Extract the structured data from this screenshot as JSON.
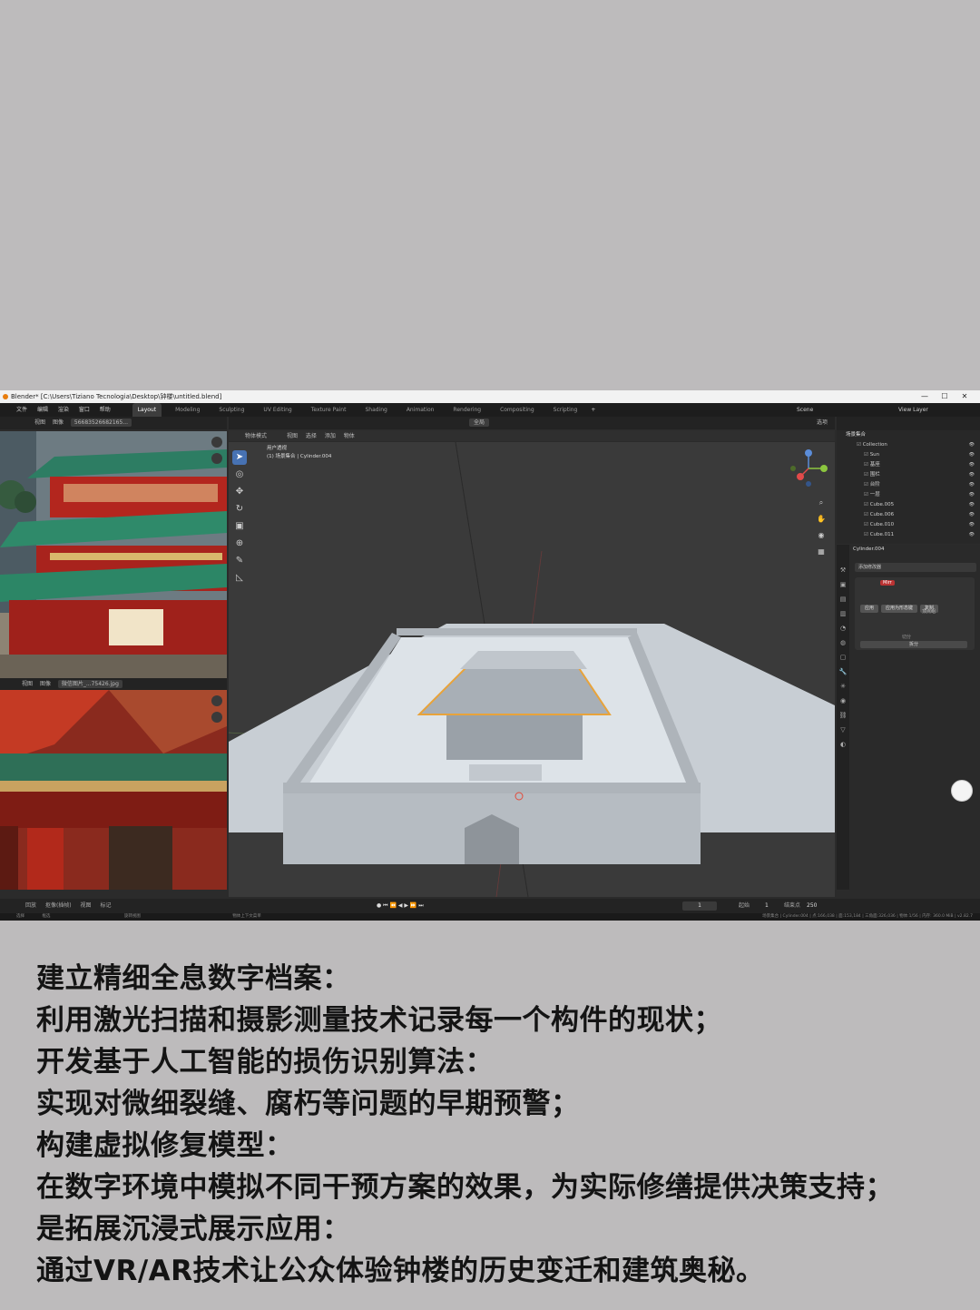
{
  "window": {
    "title": "Blender* [C:\\Users\\Tiziano Tecnologia\\Desktop\\钟楼\\untitled.blend]",
    "controls": [
      "—",
      "☐",
      "✕"
    ]
  },
  "menu": {
    "items": [
      "文件",
      "编辑",
      "渲染",
      "窗口",
      "帮助"
    ],
    "workspaces": [
      "Layout",
      "Modeling",
      "Sculpting",
      "UV Editing",
      "Texture Paint",
      "Shading",
      "Animation",
      "Rendering",
      "Compositing",
      "Scripting"
    ],
    "active_workspace": "Layout",
    "scene": "Scene",
    "view_layer": "View Layer"
  },
  "image_editor_top": {
    "menu": [
      "视图",
      "图像"
    ],
    "image_name": "566835266821​65..."
  },
  "image_editor_bottom": {
    "menu": [
      "视图",
      "图像"
    ],
    "image_name": "微信图片_...75426.jpg"
  },
  "viewport": {
    "mode": "物体模式",
    "menu": [
      "视图",
      "选择",
      "添加",
      "物体"
    ],
    "transform": "全局",
    "view_name": "用户透视",
    "object_label": "(1) 场景集合 | Cylinder.004",
    "options_label": "选项"
  },
  "outliner": {
    "header": "场景集合",
    "rows": [
      {
        "name": "Collection"
      },
      {
        "name": "Sun"
      },
      {
        "name": "基座"
      },
      {
        "name": "围栏"
      },
      {
        "name": "台阶"
      },
      {
        "name": "一层"
      },
      {
        "name": "Cube.005"
      },
      {
        "name": "Cube.006"
      },
      {
        "name": "Cube.010"
      },
      {
        "name": "Cube.011"
      }
    ]
  },
  "properties": {
    "object_name": "Cylinder.004",
    "add_modifier": "添加修改器",
    "modifier_name": "Mirr",
    "apply": "应用",
    "apply_as_shapekey": "应用为形态键",
    "copy": "复制",
    "vertex_group": "顶点组",
    "bisect_label": "切分",
    "bisect": "拆分"
  },
  "timeline": {
    "menu": [
      "回放",
      "抠像(插帧)",
      "视图",
      "标记"
    ],
    "current_frame": "1",
    "start_label": "起始",
    "start": "1",
    "end_label": "结束点",
    "end": "250"
  },
  "statusbar": {
    "left": "选择",
    "mid1": "框选",
    "mid2": "旋转视图",
    "mid3": "物体上下文菜单",
    "right": "场景集合 | Cylinder.004 | 点:166,038 | 面:153,184 | 三角面:326,036 | 物体:1/56 | 内存: 360.0 MiB | v2.82.7"
  },
  "caption_lines": [
    "建立精细全息数字档案：",
    "利用激光扫描和摄影测量技术记录每一个构件的现状；",
    "开发基于人工智能的损伤识别算法：",
    "实现对微细裂缝、腐朽等问题的早期预警；",
    "构建虚拟修复模型：",
    "在数字环境中模拟不同干预方案的效果，为实际修缮提供决策支持；",
    "是拓展沉浸式展示应用：",
    "通过VR/AR技术让公众体验钟楼的历史变迁和建筑奥秘。"
  ],
  "colors": {
    "page_bg": "#bdbbbc",
    "blender_bg": "#2b2b2b",
    "viewport_bg": "#3a3a3a",
    "accent": "#4772b3",
    "selection": "#e8a33a",
    "model": "#c9d1d8",
    "caption_text": "#141414"
  }
}
